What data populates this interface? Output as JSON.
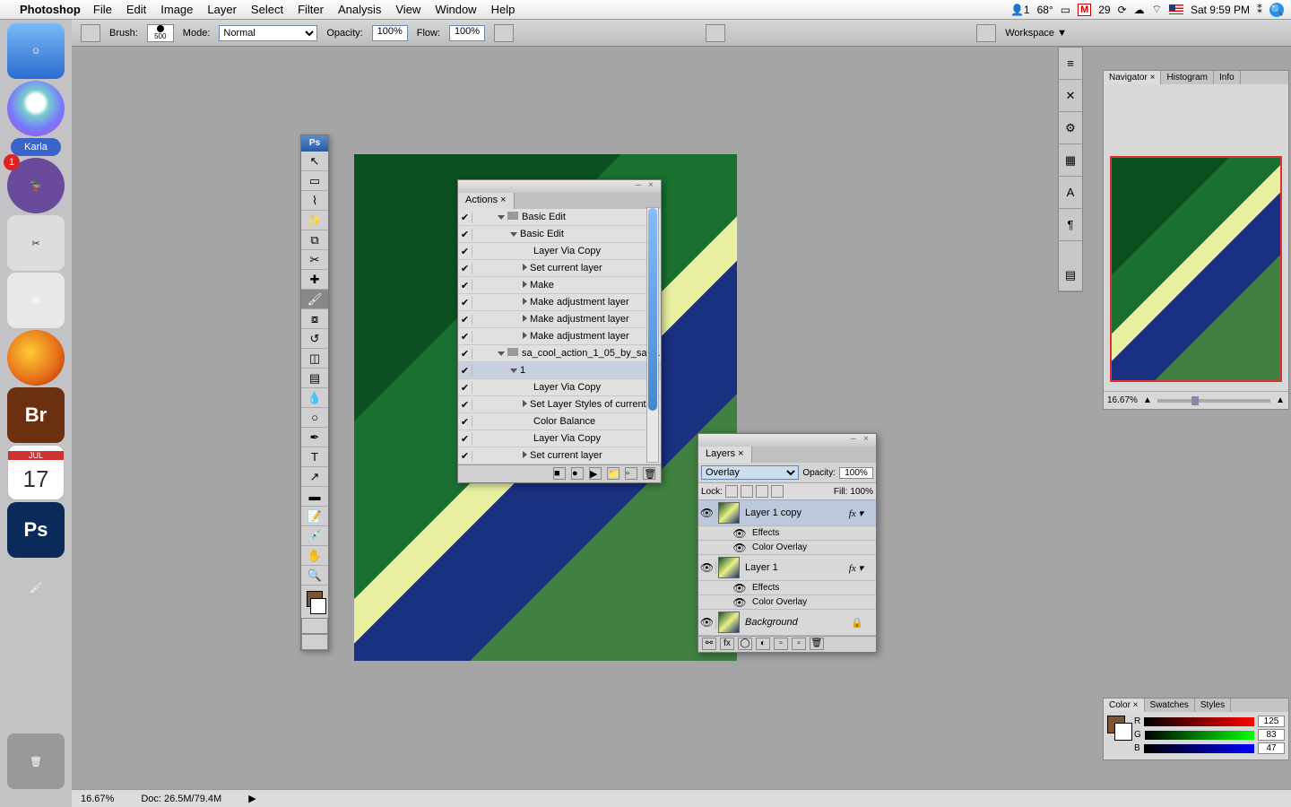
{
  "menubar": {
    "app": "Photoshop",
    "items": [
      "File",
      "Edit",
      "Image",
      "Layer",
      "Select",
      "Filter",
      "Analysis",
      "View",
      "Window",
      "Help"
    ],
    "right": {
      "temp": "68°",
      "gmail": "29",
      "clock": "Sat 9:59 PM",
      "notif": "1"
    }
  },
  "dock": {
    "karla": "Karla",
    "bridge": "Br",
    "ical_month": "JUL",
    "ical_day": "17",
    "ps": "Ps",
    "adium_badge": "1"
  },
  "optbar": {
    "brush_label": "Brush:",
    "brush_size": "500",
    "mode_label": "Mode:",
    "mode_value": "Normal",
    "opacity_label": "Opacity:",
    "opacity_value": "100%",
    "flow_label": "Flow:",
    "flow_value": "100%",
    "workspace": "Workspace ▼"
  },
  "tools_head": "Ps",
  "actions": {
    "title": "Actions",
    "rows": [
      {
        "chk": "✔",
        "indent": 1,
        "tri": "down",
        "folder": true,
        "label": "Basic Edit"
      },
      {
        "chk": "✔",
        "indent": 2,
        "tri": "down",
        "label": "Basic Edit"
      },
      {
        "chk": "✔",
        "indent": 4,
        "label": "Layer Via Copy"
      },
      {
        "chk": "✔",
        "indent": 3,
        "tri": "right",
        "label": "Set current layer"
      },
      {
        "chk": "✔",
        "indent": 3,
        "tri": "right",
        "label": "Make"
      },
      {
        "chk": "✔",
        "indent": 3,
        "tri": "right",
        "label": "Make adjustment layer"
      },
      {
        "chk": "✔",
        "indent": 3,
        "tri": "right",
        "label": "Make adjustment layer"
      },
      {
        "chk": "✔",
        "indent": 3,
        "tri": "right",
        "label": "Make adjustment layer"
      },
      {
        "chk": "✔",
        "indent": 1,
        "tri": "down",
        "folder": true,
        "label": "sa_cool_action_1_05_by_sa_..."
      },
      {
        "chk": "✔",
        "indent": 2,
        "tri": "down",
        "label": "1",
        "sel": true
      },
      {
        "chk": "✔",
        "indent": 4,
        "label": "Layer Via Copy"
      },
      {
        "chk": "✔",
        "indent": 3,
        "tri": "right",
        "label": "Set Layer Styles of current..."
      },
      {
        "chk": "✔",
        "indent": 4,
        "label": "Color Balance"
      },
      {
        "chk": "✔",
        "indent": 4,
        "label": "Layer Via Copy"
      },
      {
        "chk": "✔",
        "indent": 3,
        "tri": "right",
        "label": "Set current layer"
      }
    ]
  },
  "layers": {
    "title": "Layers",
    "blend": "Overlay",
    "opacity_label": "Opacity:",
    "opacity_value": "100%",
    "lock_label": "Lock:",
    "fill_label": "Fill:",
    "fill_value": "100%",
    "items": [
      {
        "eye": "👁",
        "name": "Layer 1 copy",
        "fx": true,
        "sel": true
      },
      {
        "sub": true,
        "eye": "👁",
        "name": "Effects"
      },
      {
        "sub": true,
        "eye": "👁",
        "name": "Color Overlay"
      },
      {
        "eye": "👁",
        "name": "Layer 1",
        "fx": true
      },
      {
        "sub": true,
        "eye": "👁",
        "name": "Effects"
      },
      {
        "sub": true,
        "eye": "👁",
        "name": "Color Overlay"
      },
      {
        "eye": "👁",
        "name": "Background",
        "locked": true,
        "italic": true
      }
    ]
  },
  "navigator": {
    "tabs": [
      "Navigator",
      "Histogram",
      "Info"
    ],
    "zoom": "16.67%"
  },
  "color": {
    "tabs": [
      "Color",
      "Swatches",
      "Styles"
    ],
    "r": "125",
    "g": "83",
    "b": "47",
    "r_label": "R",
    "g_label": "G",
    "b_label": "B"
  },
  "status": {
    "zoom": "16.67%",
    "doc": "Doc: 26.5M/79.4M"
  }
}
